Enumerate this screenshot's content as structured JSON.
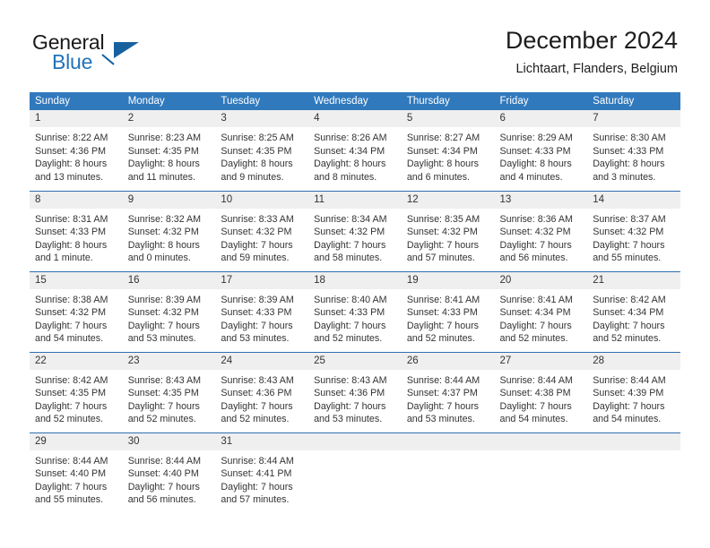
{
  "brand": {
    "name_part1": "General",
    "name_part2": "Blue",
    "logo_icon": "triangle-logo-icon"
  },
  "header": {
    "title": "December 2024",
    "subtitle": "Lichtaart, Flanders, Belgium"
  },
  "calendar": {
    "accent_color": "#3179bd",
    "rule_color": "#2f6fae",
    "daynum_band_color": "#efefef",
    "weekday_headers": [
      "Sunday",
      "Monday",
      "Tuesday",
      "Wednesday",
      "Thursday",
      "Friday",
      "Saturday"
    ],
    "weeks": [
      [
        {
          "day": "1",
          "sunrise": "Sunrise: 8:22 AM",
          "sunset": "Sunset: 4:36 PM",
          "daylight1": "Daylight: 8 hours",
          "daylight2": "and 13 minutes."
        },
        {
          "day": "2",
          "sunrise": "Sunrise: 8:23 AM",
          "sunset": "Sunset: 4:35 PM",
          "daylight1": "Daylight: 8 hours",
          "daylight2": "and 11 minutes."
        },
        {
          "day": "3",
          "sunrise": "Sunrise: 8:25 AM",
          "sunset": "Sunset: 4:35 PM",
          "daylight1": "Daylight: 8 hours",
          "daylight2": "and 9 minutes."
        },
        {
          "day": "4",
          "sunrise": "Sunrise: 8:26 AM",
          "sunset": "Sunset: 4:34 PM",
          "daylight1": "Daylight: 8 hours",
          "daylight2": "and 8 minutes."
        },
        {
          "day": "5",
          "sunrise": "Sunrise: 8:27 AM",
          "sunset": "Sunset: 4:34 PM",
          "daylight1": "Daylight: 8 hours",
          "daylight2": "and 6 minutes."
        },
        {
          "day": "6",
          "sunrise": "Sunrise: 8:29 AM",
          "sunset": "Sunset: 4:33 PM",
          "daylight1": "Daylight: 8 hours",
          "daylight2": "and 4 minutes."
        },
        {
          "day": "7",
          "sunrise": "Sunrise: 8:30 AM",
          "sunset": "Sunset: 4:33 PM",
          "daylight1": "Daylight: 8 hours",
          "daylight2": "and 3 minutes."
        }
      ],
      [
        {
          "day": "8",
          "sunrise": "Sunrise: 8:31 AM",
          "sunset": "Sunset: 4:33 PM",
          "daylight1": "Daylight: 8 hours",
          "daylight2": "and 1 minute."
        },
        {
          "day": "9",
          "sunrise": "Sunrise: 8:32 AM",
          "sunset": "Sunset: 4:32 PM",
          "daylight1": "Daylight: 8 hours",
          "daylight2": "and 0 minutes."
        },
        {
          "day": "10",
          "sunrise": "Sunrise: 8:33 AM",
          "sunset": "Sunset: 4:32 PM",
          "daylight1": "Daylight: 7 hours",
          "daylight2": "and 59 minutes."
        },
        {
          "day": "11",
          "sunrise": "Sunrise: 8:34 AM",
          "sunset": "Sunset: 4:32 PM",
          "daylight1": "Daylight: 7 hours",
          "daylight2": "and 58 minutes."
        },
        {
          "day": "12",
          "sunrise": "Sunrise: 8:35 AM",
          "sunset": "Sunset: 4:32 PM",
          "daylight1": "Daylight: 7 hours",
          "daylight2": "and 57 minutes."
        },
        {
          "day": "13",
          "sunrise": "Sunrise: 8:36 AM",
          "sunset": "Sunset: 4:32 PM",
          "daylight1": "Daylight: 7 hours",
          "daylight2": "and 56 minutes."
        },
        {
          "day": "14",
          "sunrise": "Sunrise: 8:37 AM",
          "sunset": "Sunset: 4:32 PM",
          "daylight1": "Daylight: 7 hours",
          "daylight2": "and 55 minutes."
        }
      ],
      [
        {
          "day": "15",
          "sunrise": "Sunrise: 8:38 AM",
          "sunset": "Sunset: 4:32 PM",
          "daylight1": "Daylight: 7 hours",
          "daylight2": "and 54 minutes."
        },
        {
          "day": "16",
          "sunrise": "Sunrise: 8:39 AM",
          "sunset": "Sunset: 4:32 PM",
          "daylight1": "Daylight: 7 hours",
          "daylight2": "and 53 minutes."
        },
        {
          "day": "17",
          "sunrise": "Sunrise: 8:39 AM",
          "sunset": "Sunset: 4:33 PM",
          "daylight1": "Daylight: 7 hours",
          "daylight2": "and 53 minutes."
        },
        {
          "day": "18",
          "sunrise": "Sunrise: 8:40 AM",
          "sunset": "Sunset: 4:33 PM",
          "daylight1": "Daylight: 7 hours",
          "daylight2": "and 52 minutes."
        },
        {
          "day": "19",
          "sunrise": "Sunrise: 8:41 AM",
          "sunset": "Sunset: 4:33 PM",
          "daylight1": "Daylight: 7 hours",
          "daylight2": "and 52 minutes."
        },
        {
          "day": "20",
          "sunrise": "Sunrise: 8:41 AM",
          "sunset": "Sunset: 4:34 PM",
          "daylight1": "Daylight: 7 hours",
          "daylight2": "and 52 minutes."
        },
        {
          "day": "21",
          "sunrise": "Sunrise: 8:42 AM",
          "sunset": "Sunset: 4:34 PM",
          "daylight1": "Daylight: 7 hours",
          "daylight2": "and 52 minutes."
        }
      ],
      [
        {
          "day": "22",
          "sunrise": "Sunrise: 8:42 AM",
          "sunset": "Sunset: 4:35 PM",
          "daylight1": "Daylight: 7 hours",
          "daylight2": "and 52 minutes."
        },
        {
          "day": "23",
          "sunrise": "Sunrise: 8:43 AM",
          "sunset": "Sunset: 4:35 PM",
          "daylight1": "Daylight: 7 hours",
          "daylight2": "and 52 minutes."
        },
        {
          "day": "24",
          "sunrise": "Sunrise: 8:43 AM",
          "sunset": "Sunset: 4:36 PM",
          "daylight1": "Daylight: 7 hours",
          "daylight2": "and 52 minutes."
        },
        {
          "day": "25",
          "sunrise": "Sunrise: 8:43 AM",
          "sunset": "Sunset: 4:36 PM",
          "daylight1": "Daylight: 7 hours",
          "daylight2": "and 53 minutes."
        },
        {
          "day": "26",
          "sunrise": "Sunrise: 8:44 AM",
          "sunset": "Sunset: 4:37 PM",
          "daylight1": "Daylight: 7 hours",
          "daylight2": "and 53 minutes."
        },
        {
          "day": "27",
          "sunrise": "Sunrise: 8:44 AM",
          "sunset": "Sunset: 4:38 PM",
          "daylight1": "Daylight: 7 hours",
          "daylight2": "and 54 minutes."
        },
        {
          "day": "28",
          "sunrise": "Sunrise: 8:44 AM",
          "sunset": "Sunset: 4:39 PM",
          "daylight1": "Daylight: 7 hours",
          "daylight2": "and 54 minutes."
        }
      ],
      [
        {
          "day": "29",
          "sunrise": "Sunrise: 8:44 AM",
          "sunset": "Sunset: 4:40 PM",
          "daylight1": "Daylight: 7 hours",
          "daylight2": "and 55 minutes."
        },
        {
          "day": "30",
          "sunrise": "Sunrise: 8:44 AM",
          "sunset": "Sunset: 4:40 PM",
          "daylight1": "Daylight: 7 hours",
          "daylight2": "and 56 minutes."
        },
        {
          "day": "31",
          "sunrise": "Sunrise: 8:44 AM",
          "sunset": "Sunset: 4:41 PM",
          "daylight1": "Daylight: 7 hours",
          "daylight2": "and 57 minutes."
        },
        {
          "day": "",
          "sunrise": "",
          "sunset": "",
          "daylight1": "",
          "daylight2": ""
        },
        {
          "day": "",
          "sunrise": "",
          "sunset": "",
          "daylight1": "",
          "daylight2": ""
        },
        {
          "day": "",
          "sunrise": "",
          "sunset": "",
          "daylight1": "",
          "daylight2": ""
        },
        {
          "day": "",
          "sunrise": "",
          "sunset": "",
          "daylight1": "",
          "daylight2": ""
        }
      ]
    ]
  }
}
